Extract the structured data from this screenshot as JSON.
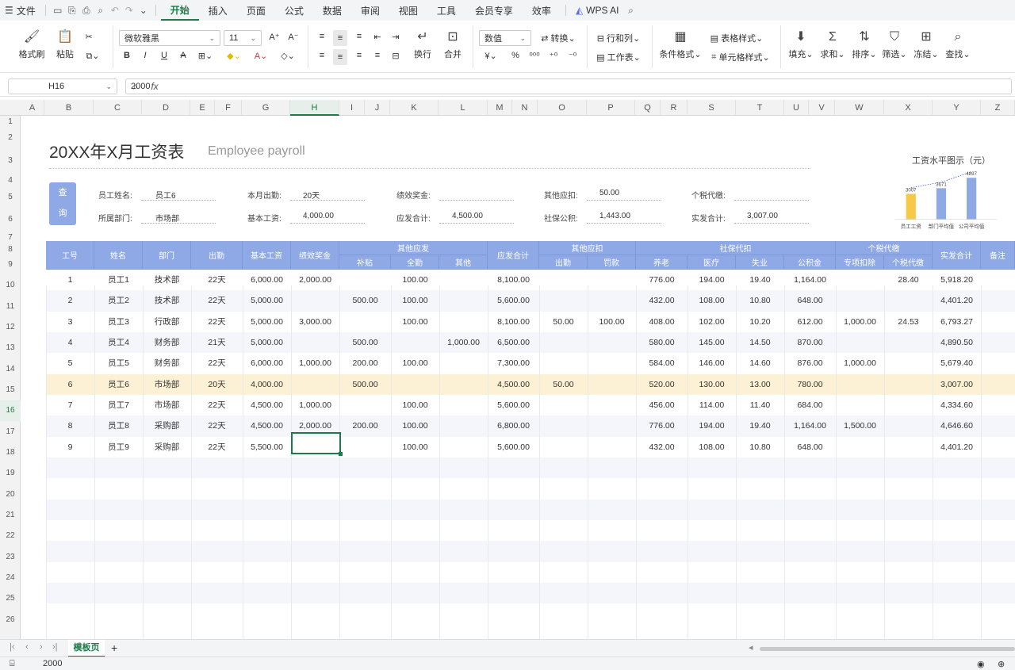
{
  "menu": {
    "file": "文件",
    "tabs": [
      "开始",
      "插入",
      "页面",
      "公式",
      "数据",
      "审阅",
      "视图",
      "工具",
      "会员专享",
      "效率"
    ],
    "wps_ai": "WPS AI"
  },
  "ribbon": {
    "format_painter": "格式刷",
    "paste": "粘贴",
    "font_name": "微软雅黑",
    "font_size": "11",
    "wrap": "换行",
    "merge": "合并",
    "number_format": "数值",
    "convert": "转换",
    "row_col": "行和列",
    "worksheet": "工作表",
    "table_style": "表格样式",
    "cell_style": "单元格样式",
    "cond_format": "条件格式",
    "fill": "填充",
    "sum": "求和",
    "sort": "排序",
    "filter": "筛选",
    "freeze": "冻结",
    "find": "查找",
    "currency": "¥",
    "percent": "%"
  },
  "formula_bar": {
    "cell_ref": "H16",
    "fx": "fx",
    "value": "2000"
  },
  "columns": [
    "A",
    "B",
    "C",
    "D",
    "E",
    "F",
    "G",
    "H",
    "I",
    "J",
    "K",
    "L",
    "M",
    "N",
    "O",
    "P",
    "Q",
    "R",
    "S",
    "T",
    "U",
    "V",
    "W",
    "X",
    "Y",
    "Z"
  ],
  "rows": [
    "1",
    "2",
    "3",
    "4",
    "5",
    "6",
    "7",
    "8",
    "9",
    "10",
    "11",
    "12",
    "13",
    "14",
    "15",
    "16",
    "17",
    "18",
    "19",
    "20",
    "21",
    "22",
    "23",
    "24",
    "25",
    "26"
  ],
  "sheet": {
    "title": "20XX年X月工资表",
    "subtitle": "Employee payroll",
    "query_button": [
      "查",
      "询"
    ],
    "info": {
      "emp_name_label": "员工姓名:",
      "emp_name": "员工6",
      "dept_label": "所属部门:",
      "dept": "市场部",
      "attend_label": "本月出勤:",
      "attend": "20天",
      "base_label": "基本工资:",
      "base": "4,000.00",
      "perf_label": "绩效奖金:",
      "perf": "",
      "due_label": "应发合计:",
      "due": "4,500.00",
      "other_deduct_label": "其他应扣:",
      "other_deduct": "50.00",
      "social_label": "社保公积:",
      "social": "1,443.00",
      "tax_label": "个税代缴:",
      "tax": "",
      "net_label": "实发合计:",
      "net": "3,007.00"
    },
    "chart_data": {
      "type": "bar",
      "title": "工资水平图示（元）",
      "categories": [
        "员工工资",
        "部门平均值",
        "公司平均值"
      ],
      "values": [
        3007,
        3671,
        4897
      ],
      "colors": [
        "#f7c948",
        "#8fa9e6",
        "#8fa9e6"
      ],
      "trendline": "dotted"
    },
    "header1": [
      "工号",
      "姓名",
      "部门",
      "出勤",
      "基本工资",
      "绩效奖金",
      "其他应发",
      "应发合计",
      "其他应扣",
      "社保代扣",
      "个税代缴",
      "实发合计",
      "备注"
    ],
    "header2": [
      "补贴",
      "全勤",
      "其他",
      "出勤",
      "罚款",
      "养老",
      "医疗",
      "失业",
      "公积金",
      "专项扣除",
      "个税代缴"
    ],
    "data": [
      [
        "1",
        "员工1",
        "技术部",
        "22天",
        "6,000.00",
        "2,000.00",
        "",
        "100.00",
        "",
        "8,100.00",
        "",
        "",
        "776.00",
        "194.00",
        "19.40",
        "1,164.00",
        "",
        "28.40",
        "5,918.20"
      ],
      [
        "2",
        "员工2",
        "技术部",
        "22天",
        "5,000.00",
        "",
        "500.00",
        "100.00",
        "",
        "5,600.00",
        "",
        "",
        "432.00",
        "108.00",
        "10.80",
        "648.00",
        "",
        "",
        "4,401.20"
      ],
      [
        "3",
        "员工3",
        "行政部",
        "22天",
        "5,000.00",
        "3,000.00",
        "",
        "100.00",
        "",
        "8,100.00",
        "50.00",
        "100.00",
        "408.00",
        "102.00",
        "10.20",
        "612.00",
        "1,000.00",
        "24.53",
        "6,793.27"
      ],
      [
        "4",
        "员工4",
        "财务部",
        "21天",
        "5,000.00",
        "",
        "500.00",
        "",
        "1,000.00",
        "6,500.00",
        "",
        "",
        "580.00",
        "145.00",
        "14.50",
        "870.00",
        "",
        "",
        "4,890.50"
      ],
      [
        "5",
        "员工5",
        "财务部",
        "22天",
        "6,000.00",
        "1,000.00",
        "200.00",
        "100.00",
        "",
        "7,300.00",
        "",
        "",
        "584.00",
        "146.00",
        "14.60",
        "876.00",
        "1,000.00",
        "",
        "5,679.40"
      ],
      [
        "6",
        "员工6",
        "市场部",
        "20天",
        "4,000.00",
        "",
        "500.00",
        "",
        "",
        "4,500.00",
        "50.00",
        "",
        "520.00",
        "130.00",
        "13.00",
        "780.00",
        "",
        "",
        "3,007.00"
      ],
      [
        "7",
        "员工7",
        "市场部",
        "22天",
        "4,500.00",
        "1,000.00",
        "",
        "100.00",
        "",
        "5,600.00",
        "",
        "",
        "456.00",
        "114.00",
        "11.40",
        "684.00",
        "",
        "",
        "4,334.60"
      ],
      [
        "8",
        "员工8",
        "采购部",
        "22天",
        "4,500.00",
        "2,000.00",
        "200.00",
        "100.00",
        "",
        "6,800.00",
        "",
        "",
        "776.00",
        "194.00",
        "19.40",
        "1,164.00",
        "1,500.00",
        "",
        "4,646.60"
      ],
      [
        "9",
        "员工9",
        "采购部",
        "22天",
        "5,500.00",
        "",
        "",
        "100.00",
        "",
        "5,600.00",
        "",
        "",
        "432.00",
        "108.00",
        "10.80",
        "648.00",
        "",
        "",
        "4,401.20"
      ]
    ]
  },
  "sheet_tabs": {
    "active": "模板页",
    "add": "+"
  },
  "status": {
    "value": "2000"
  }
}
